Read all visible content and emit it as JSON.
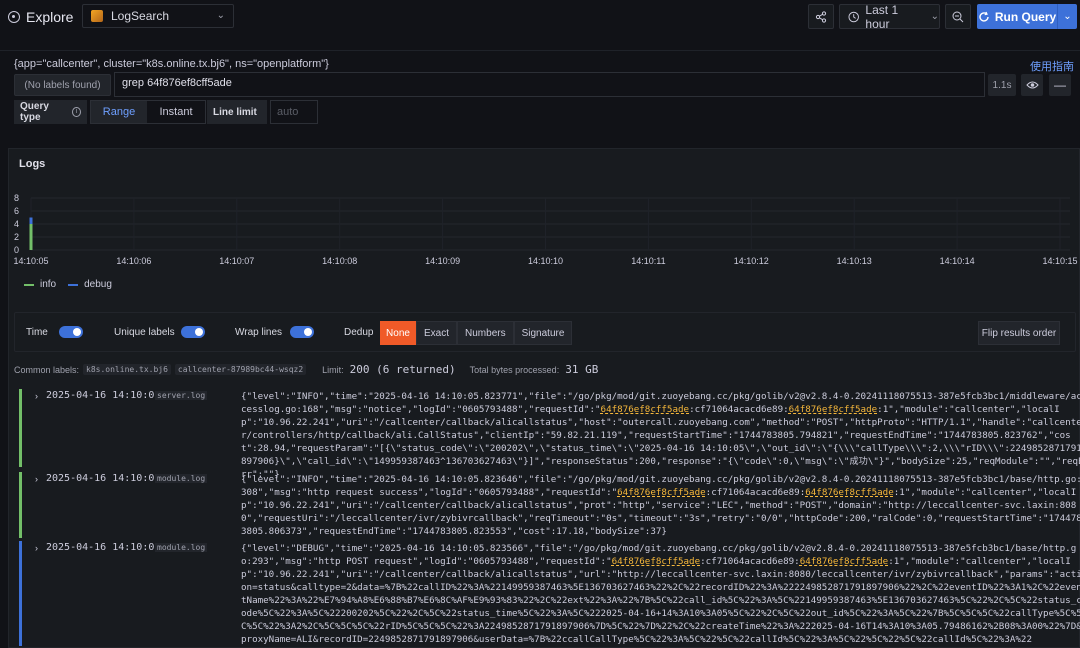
{
  "topbar": {
    "title": "Explore",
    "datasource": "LogSearch",
    "time_range": "Last 1 hour",
    "run_query": "Run Query",
    "icons": [
      "explore-icon",
      "share-icon",
      "clock-icon",
      "zoom-out-icon",
      "refresh-icon",
      "chevron-down-icon"
    ]
  },
  "query": {
    "selector": "{app=\"callcenter\", cluster=\"k8s.online.tx.bj6\", ns=\"openplatform\"}",
    "guide_link": "使用指南",
    "labels_button": "(No labels found)",
    "expression": "grep 64f876ef8cff5ade",
    "duration": "1.1s",
    "query_type_label": "Query type",
    "query_types": [
      "Range",
      "Instant"
    ],
    "selected_query_type": "Range",
    "line_limit_label": "Line limit",
    "line_limit_placeholder": "auto"
  },
  "logs_panel": {
    "title": "Logs",
    "legend": [
      {
        "name": "info",
        "color": "#73bf69"
      },
      {
        "name": "debug",
        "color": "#3d71d9"
      }
    ]
  },
  "chart_data": {
    "type": "bar",
    "x": [
      "14:10:05",
      "14:10:06",
      "14:10:07",
      "14:10:08",
      "14:10:09",
      "14:10:10",
      "14:10:11",
      "14:10:12",
      "14:10:13",
      "14:10:14",
      "14:10:15"
    ],
    "y_ticks": [
      0,
      2,
      4,
      6,
      8
    ],
    "ylim": [
      0,
      8
    ],
    "series": [
      {
        "name": "info",
        "color": "#73bf69",
        "values": [
          4,
          0,
          0,
          0,
          0,
          0,
          0,
          0,
          0,
          0,
          0
        ]
      },
      {
        "name": "debug",
        "color": "#3d71d9",
        "values": [
          1,
          0,
          0,
          0,
          0,
          0,
          0,
          0,
          0,
          0,
          0
        ]
      }
    ],
    "stacked": true,
    "legend_position": "bottom-left"
  },
  "controls": {
    "time": "Time",
    "unique_labels": "Unique labels",
    "wrap_lines": "Wrap lines",
    "dedup_label": "Dedup",
    "dedup_options": [
      "None",
      "Exact",
      "Numbers",
      "Signature"
    ],
    "dedup_selected": "None",
    "flip": "Flip results order"
  },
  "meta": {
    "common_labels_label": "Common labels:",
    "common_labels": [
      "k8s.online.tx.bj6",
      "callcenter-87989bc44-wsqz2"
    ],
    "limit_label": "Limit:",
    "limit_value": "200 (6 returned)",
    "bytes_label": "Total bytes processed:",
    "bytes_value": "31 GB"
  },
  "log_rows": [
    {
      "level_color": "#73bf69",
      "timestamp": "2025-04-16 14:10:05",
      "file": "server.log",
      "message_parts": [
        "{\"level\":\"INFO\",\"time\":\"2025-04-16 14:10:05.823771\",\"file\":\"/go/pkg/mod/git.zuoyebang.cc/pkg/golib/v2@v2.8.4-0.20241118075513-387e5fcb3bc1/middleware/accesslog.go:168\",\"msg\":\"notice\",\"logId\":\"0605793488\",\"requestId\":\"",
        "64f876ef8cff5ade",
        ":cf71064acacd6e89:",
        "64f876ef8cff5ade",
        ":1\",\"module\":\"callcenter\",\"localIp\":\"10.96.22.241\",\"uri\":\"/callcenter/callback/alicallstatus\",\"host\":\"outercall.zuoyebang.com\",\"method\":\"POST\",\"httpProto\":\"HTTP/1.1\",\"handle\":\"callcenter/controllers/http/callback/ali.CallStatus\",\"clientIp\":\"59.82.21.119\",\"requestStartTime\":\"1744783805.794821\",\"requestEndTime\":\"1744783805.823762\",\"cost\":28.94,\"requestParam\":\"[{\\\"status_code\\\":\\\"200202\\\",\\\"status_time\\\":\\\"2025-04-16 14:10:05\\\",\\\"out_id\\\":\\\"{\\\\\\\"callType\\\\\\\":2,\\\\\\\"rID\\\\\\\":2249852871791897906}\\\",\\\"call_id\\\":\\\"149959387463^136703627463\\\"}]\",\"responseStatus\":200,\"response\":\"{\\\"code\\\":0,\\\"msg\\\":\\\"成功\\\"}\",\"bodySize\":25,\"reqModule\":\"\",\"reqErr\":\"\"}"
      ]
    },
    {
      "level_color": "#73bf69",
      "timestamp": "2025-04-16 14:10:05",
      "file": "module.log",
      "message_parts": [
        "{\"level\":\"INFO\",\"time\":\"2025-04-16 14:10:05.823646\",\"file\":\"/go/pkg/mod/git.zuoyebang.cc/pkg/golib/v2@v2.8.4-0.20241118075513-387e5fcb3bc1/base/http.go:308\",\"msg\":\"http request success\",\"logId\":\"0605793488\",\"requestId\":\"",
        "64f876ef8cff5ade",
        ":cf71064acacd6e89:",
        "64f876ef8cff5ade",
        ":1\",\"module\":\"callcenter\",\"localIp\":\"10.96.22.241\",\"uri\":\"/callcenter/callback/alicallstatus\",\"prot\":\"http\",\"service\":\"LEC\",\"method\":\"POST\",\"domain\":\"http://leccallcenter-svc.laxin:8080\",\"requestUri\":\"/leccallcenter/ivr/zybivrcallback\",\"reqTimeout\":\"0s\",\"timeout\":\"3s\",\"retry\":\"0/0\",\"httpCode\":200,\"ralCode\":0,\"requestStartTime\":\"1744783805.806373\",\"requestEndTime\":\"1744783805.823553\",\"cost\":17.18,\"bodySize\":37}"
      ]
    },
    {
      "level_color": "#3d71d9",
      "timestamp": "2025-04-16 14:10:05",
      "file": "module.log",
      "message_parts": [
        "{\"level\":\"DEBUG\",\"time\":\"2025-04-16 14:10:05.823566\",\"file\":\"/go/pkg/mod/git.zuoyebang.cc/pkg/golib/v2@v2.8.4-0.20241118075513-387e5fcb3bc1/base/http.go:293\",\"msg\":\"http POST request\",\"logId\":\"0605793488\",\"requestId\":\"",
        "64f876ef8cff5ade",
        ":cf71064acacd6e89:",
        "64f876ef8cff5ade",
        ":1\",\"module\":\"callcenter\",\"localIp\":\"10.96.22.241\",\"uri\":\"/callcenter/callback/alicallstatus\",\"url\":\"http://leccallcenter-svc.laxin:8080/leccallcenter/ivr/zybivrcallback\",\"params\":\"action=status&calltype=2&data=%7B%22callID%22%3A%22149959387463%5E136703627463%22%2C%22recordID%22%3A%222249852871791897906%22%2C%22eventID%22%3A1%2C%22eventName%22%3A%22%E7%94%A8%E6%88%B7%E6%8C%AF%E9%93%83%22%2C%22ext%22%3A%22%7B%5C%22call_id%5C%22%3A%5C%22149959387463%5E136703627463%5C%22%2C%5C%22status_code%5C%22%3A%5C%22200202%5C%22%2C%5C%22status_time%5C%22%3A%5C%222025-04-16+14%3A10%3A05%5C%22%2C%5C%22out_id%5C%22%3A%5C%22%7B%5C%5C%5C%22callType%5C%5C%5C%22%3A2%2C%5C%5C%5C%22rID%5C%5C%5C%22%3A2249852871791897906%7D%5C%22%7D%22%2C%22createTime%22%3A%222025-04-16T14%3A10%3A05.79486162%2B08%3A00%22%7D&proxyName=ALI&recordID=2249852871791897906&userData=%7B%22ccallCallType%5C%22%3A%5C%22%5C%22callId%5C%22%3A%5C%22%5C%22%5C%22callId%5C%22%3A%22"
      ]
    }
  ]
}
